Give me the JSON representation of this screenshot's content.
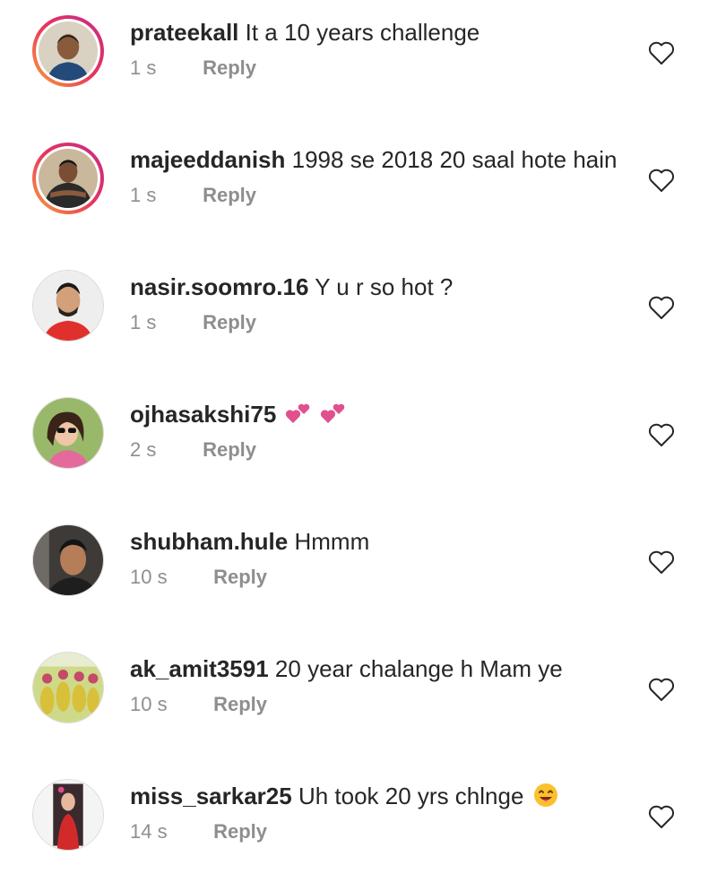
{
  "reply_label": "Reply",
  "comments": [
    {
      "username": "prateekall",
      "text": "It a 10 years challenge",
      "time": "1 s",
      "story_ring": true,
      "avatar_icon": "user-avatar"
    },
    {
      "username": "majeeddanish",
      "text": "1998 se 2018 20 saal hote hain",
      "time": "1 s",
      "story_ring": true,
      "avatar_icon": "user-avatar"
    },
    {
      "username": "nasir.soomro.16",
      "text": "Y u r so hot ?",
      "time": "1 s",
      "story_ring": false,
      "avatar_icon": "user-avatar"
    },
    {
      "username": "ojhasakshi75",
      "text": "",
      "time": "2 s",
      "story_ring": false,
      "avatar_icon": "user-avatar",
      "emoji": "two-hearts-emoji x2"
    },
    {
      "username": "shubham.hule",
      "text": "Hmmm",
      "time": "10 s",
      "story_ring": false,
      "avatar_icon": "user-avatar"
    },
    {
      "username": "ak_amit3591",
      "text": "20 year chalange  h Mam ye",
      "time": "10 s",
      "story_ring": false,
      "avatar_icon": "user-avatar"
    },
    {
      "username": "miss_sarkar25",
      "text": "Uh took 20 yrs chlnge",
      "time": "14 s",
      "story_ring": false,
      "avatar_icon": "user-avatar",
      "emoji": "smiling-face-emoji"
    }
  ],
  "colors": {
    "username": "#262626",
    "meta": "#8e8e8e",
    "story_ring_start": "#f9a23a",
    "story_ring_end": "#c42d87"
  }
}
